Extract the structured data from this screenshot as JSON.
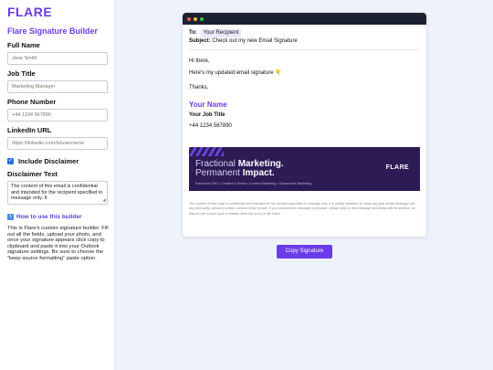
{
  "brand": {
    "logo": "FLARE",
    "accent": "#6a3de8"
  },
  "sidebar": {
    "title": "Flare Signature Builder",
    "fields": {
      "full_name": {
        "label": "Full Name",
        "placeholder": "Jane Smith"
      },
      "job_title": {
        "label": "Job Title",
        "placeholder": "Marketing Manager"
      },
      "phone": {
        "label": "Phone Number",
        "placeholder": "+44 1234 567890"
      },
      "linkedin": {
        "label": "LinkedIn URL",
        "placeholder": "https://linkedin.com/in/username"
      }
    },
    "include_disclaimer": {
      "label": "Include Disclaimer",
      "checked": true
    },
    "disclaimer": {
      "label": "Disclaimer Text",
      "value": "The content of this email is confidential and intended for the recipient specified in message only. It"
    },
    "howto": {
      "link_text": "How to use this builder",
      "description": "This is Flare's custom signature builder. Fill out all the fields, upload your photo, and once your signature appears click copy to clipboard and paste it into your Outlook signature settings. Be sure to choose the \"keep source formatting\" paste option."
    }
  },
  "email": {
    "to_label": "To:",
    "to_value": "Your Recipient",
    "subject_label": "Subject:",
    "subject_value": "Check out my new Email Signature",
    "greeting": "Hi there,",
    "message": "Here's my updated email signature 👇",
    "thanks": "Thanks,",
    "signature": {
      "name": "Your Name",
      "title": "Your Job Title",
      "phone": "+44 1234 567890"
    },
    "banner": {
      "line1_light": "Fractional ",
      "line1_bold": "Marketing.",
      "line2_light": "Permanent ",
      "line2_bold": "Impact.",
      "tags": "Fractional CMO  •  Creative & Brand  •  Content Marketing  •  Outsourced Marketing",
      "logo": "FLARE"
    },
    "disclaimer": "The content of this email is confidential and intended for the recipient specified in message only. It is strictly forbidden to share any part of this message with any third party, without a written consent of the sender. If you received this message by mistake, please reply to this message and follow with its deletion, so that we can ensure such a mistake does not occur in the future."
  },
  "copy_button": "Copy Signature"
}
